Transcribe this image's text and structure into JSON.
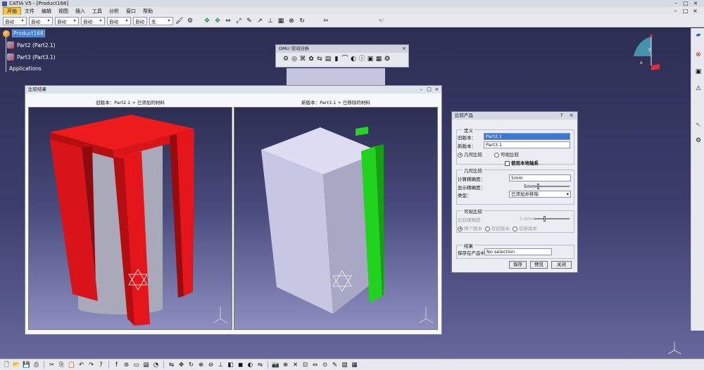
{
  "app": {
    "title": "CATIA V5 - [Product168]"
  },
  "menu": [
    "开始",
    "文件",
    "编辑",
    "视图",
    "插入",
    "工具",
    "分析",
    "窗口",
    "帮助"
  ],
  "style_toolbar": {
    "combos": [
      "自动",
      "自动",
      "自动",
      "自动",
      "自动",
      "自动",
      "无"
    ]
  },
  "tree": {
    "root": "Product168",
    "children": [
      "Part2 (Part2.1)",
      "Part3 (Part3.1)"
    ],
    "applications": "Applications"
  },
  "dmu_toolbar": {
    "title": "DMU 空间分析"
  },
  "compare_window": {
    "title": "比较结果",
    "old_caption": "旧版本：Part2.1 + 已添加的材料",
    "new_caption": "新版本：Part3.1 + 已移除的材料",
    "colors": {
      "added": "#e8161a",
      "removed": "#19d218",
      "old_body": "#b9b9c9",
      "new_body": "#c8c7e3"
    }
  },
  "dialog": {
    "title": "比较产品",
    "def_legend": "定义",
    "old_label": "旧版本：",
    "old_value": "Part2.1",
    "new_label": "新版本：",
    "new_value": "Part3.1",
    "geo_compare": "几何比较",
    "visual_compare": "可视比较",
    "local_axis": "使用本地轴系",
    "geo_legend": "几何比较",
    "calc_label": "计算精确度：",
    "calc_value": "5mm",
    "disp_label": "显示精确度：",
    "disp_value": "5mm",
    "type_label": "类型：",
    "type_value": "已添加并移除",
    "vis_legend": "可视比较",
    "vis_prec_label": "比较精确度：",
    "vis_prec_value": "0.4mm",
    "vis_opt1": "两个版本",
    "vis_opt2": "仅旧版本",
    "vis_opt3": "仅新版本",
    "result_legend": "结果",
    "save_label": "保存在产品中",
    "save_value": "No selection",
    "buttons": {
      "save": "保存",
      "preview": "预览",
      "close": "关闭"
    }
  }
}
